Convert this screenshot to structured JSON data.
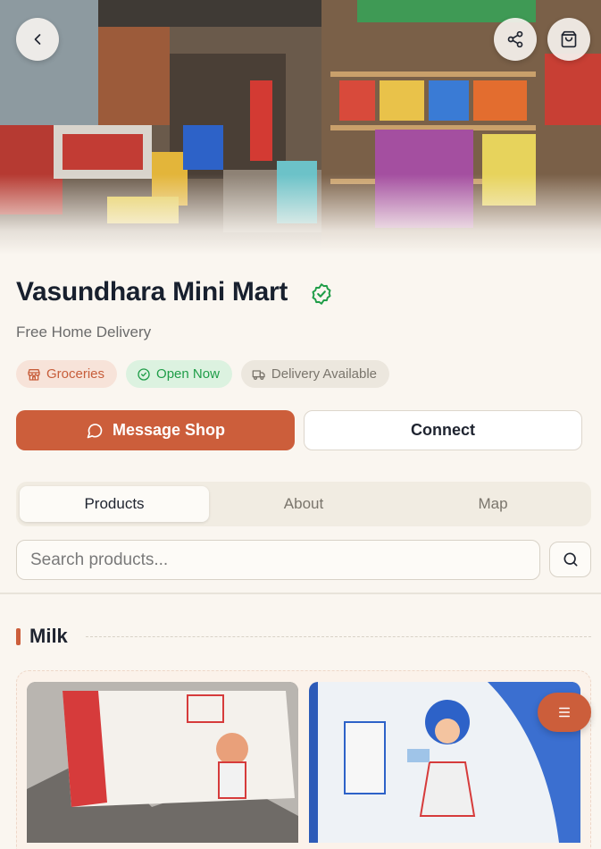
{
  "header": {
    "back_icon": "chevron-left-icon",
    "share_icon": "share-icon",
    "cart_icon": "shopping-bag-icon"
  },
  "shop": {
    "name": "Vasundhara Mini Mart",
    "tagline": "Free Home Delivery",
    "verified": true
  },
  "badges": [
    {
      "label": "Groceries",
      "icon": "store-icon"
    },
    {
      "label": "Open Now",
      "icon": "check-circle-icon"
    },
    {
      "label": "Delivery Available",
      "icon": "truck-icon"
    }
  ],
  "actions": {
    "message_label": "Message Shop",
    "connect_label": "Connect"
  },
  "tabs": [
    {
      "label": "Products",
      "active": true
    },
    {
      "label": "About",
      "active": false
    },
    {
      "label": "Map",
      "active": false
    }
  ],
  "search": {
    "placeholder": "Search products...",
    "value": ""
  },
  "section": {
    "title": "Milk"
  },
  "colors": {
    "accent": "#cc5e3b",
    "background": "#faf6f0",
    "success": "#1f9d48"
  }
}
